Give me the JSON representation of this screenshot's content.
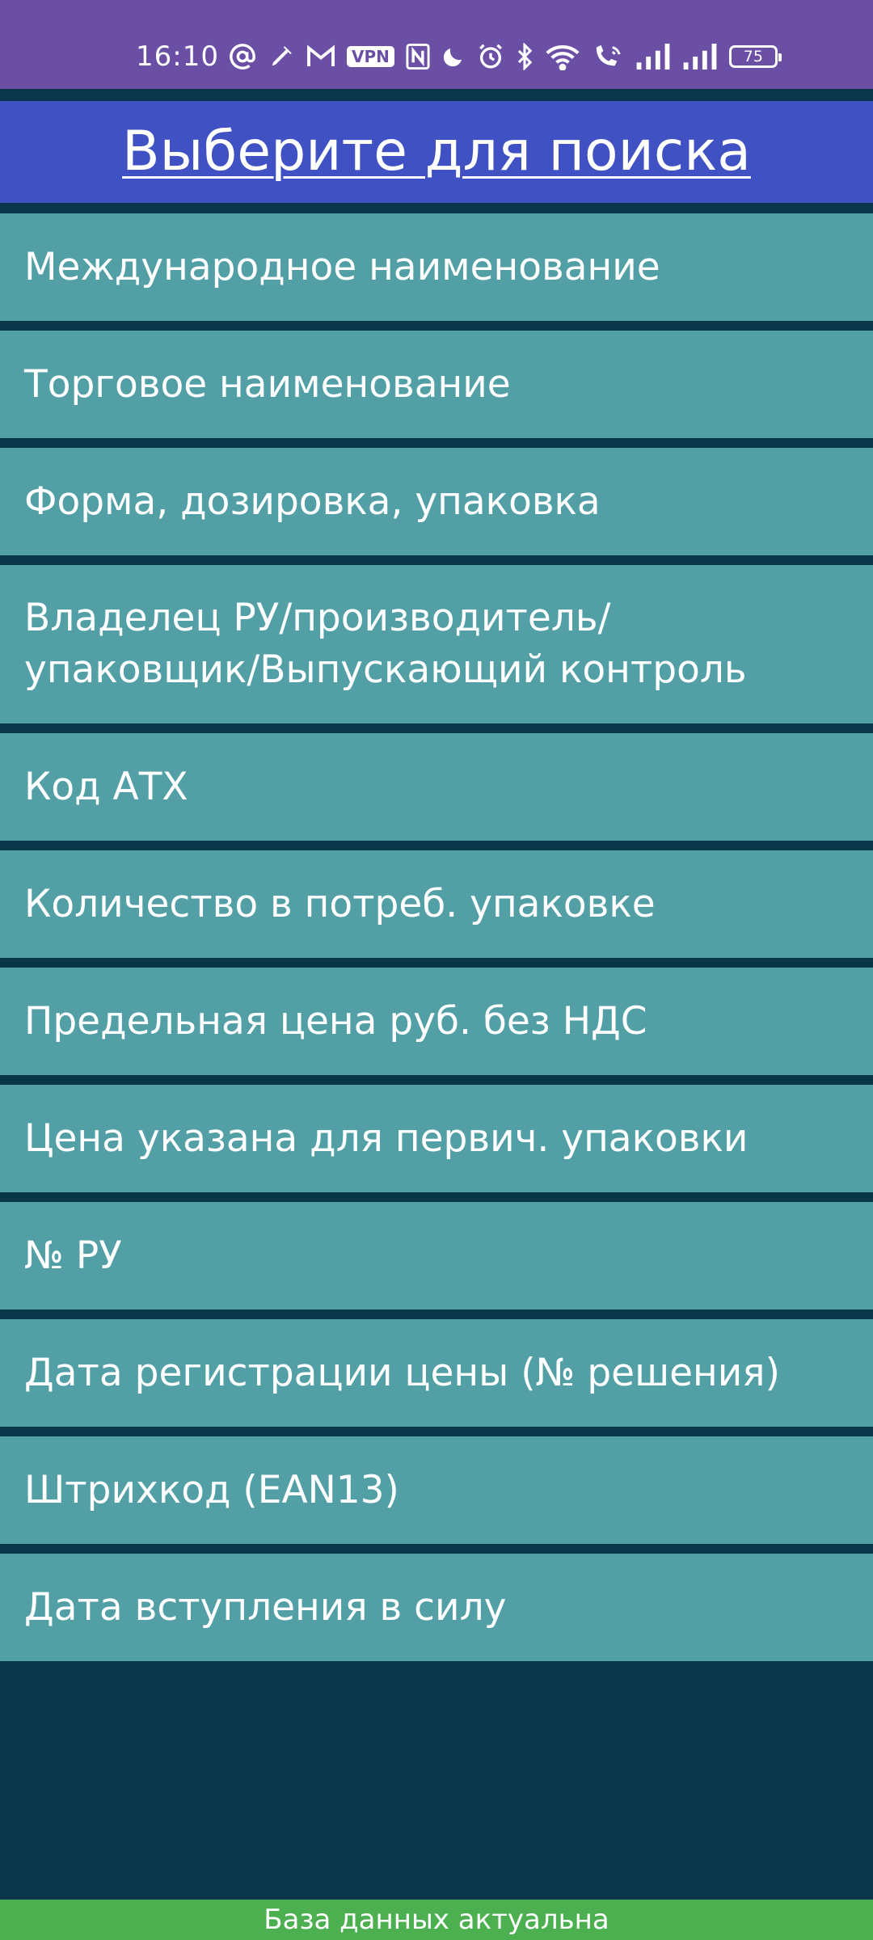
{
  "status_bar": {
    "time": "16:10",
    "vpn_label": "VPN",
    "battery_level": "75",
    "icons": [
      "at-icon",
      "pen-icon",
      "gmail-icon",
      "vpn-icon",
      "nfc-icon",
      "moon-icon",
      "alarm-icon",
      "bluetooth-icon",
      "wifi-icon",
      "wifi-call-icon",
      "signal-icon",
      "signal-icon",
      "battery-icon"
    ]
  },
  "header": {
    "title": "Выберите для поиска"
  },
  "menu": {
    "items": [
      {
        "label": "Международное наименование"
      },
      {
        "label": "Торговое наименование"
      },
      {
        "label": "Форма, дозировка, упаковка"
      },
      {
        "label": "Владелец РУ/производитель/ упаковщик/Выпускающий контроль"
      },
      {
        "label": "Код АТХ"
      },
      {
        "label": "Количество в потреб. упаковке"
      },
      {
        "label": "Предельная цена руб. без НДС"
      },
      {
        "label": "Цена указана для первич. упаковки"
      },
      {
        "label": "№ РУ"
      },
      {
        "label": "Дата регистрации цены (№ решения)"
      },
      {
        "label": "Штрихкод (EAN13)"
      },
      {
        "label": "Дата вступления в силу"
      }
    ]
  },
  "footer": {
    "status": "База данных актуальна"
  },
  "colors": {
    "status_bar": "#6a4fa5",
    "header": "#4051c3",
    "item": "#52a0a6",
    "background": "#0b3549",
    "footer": "#4caf50"
  }
}
